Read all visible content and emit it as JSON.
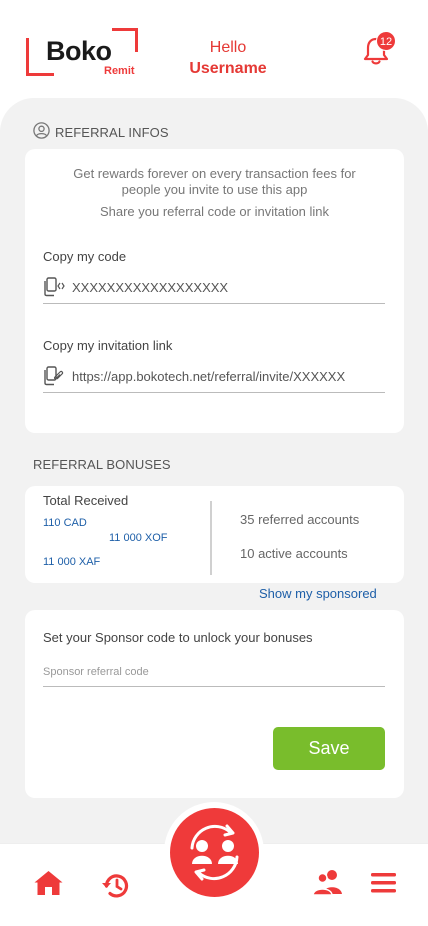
{
  "header": {
    "logo_word": "Boko",
    "logo_sub": "Remit",
    "hello": "Hello",
    "username": "Username",
    "notification_count": "12",
    "icons": {
      "bell": "bell-icon"
    }
  },
  "referral_infos": {
    "title": "REFERRAL INFOS",
    "description_line1": "Get rewards forever on every transaction fees for",
    "description_line2": "people you invite to use this app",
    "share_text": "Share you referral code or invitation link",
    "code_label": "Copy my code",
    "code_value": "XXXXXXXXXXXXXXXXXX",
    "link_label": "Copy my invitation link",
    "link_value": "https://app.bokotech.net/referral/invite/XXXXXX"
  },
  "referral_bonuses": {
    "title": "REFERRAL BONUSES",
    "total_label": "Total Received",
    "amounts": [
      "110 CAD",
      "11 000 XOF",
      "11 000 XAF"
    ],
    "referred": "35 referred accounts",
    "active": "10 active accounts",
    "show_sponsored": "Show my sponsored"
  },
  "sponsor": {
    "title": "Set your Sponsor code to unlock your bonuses",
    "placeholder": "Sponsor referral code",
    "save_label": "Save"
  },
  "nav": {
    "items": [
      "home-icon",
      "history-icon",
      "referral-exchange-icon",
      "users-icon",
      "menu-icon"
    ]
  },
  "colors": {
    "brand_red": "#ee3a3a",
    "link_blue": "#1e5fa8",
    "save_green": "#79bd2c",
    "panel_bg": "#f2f2f2"
  }
}
